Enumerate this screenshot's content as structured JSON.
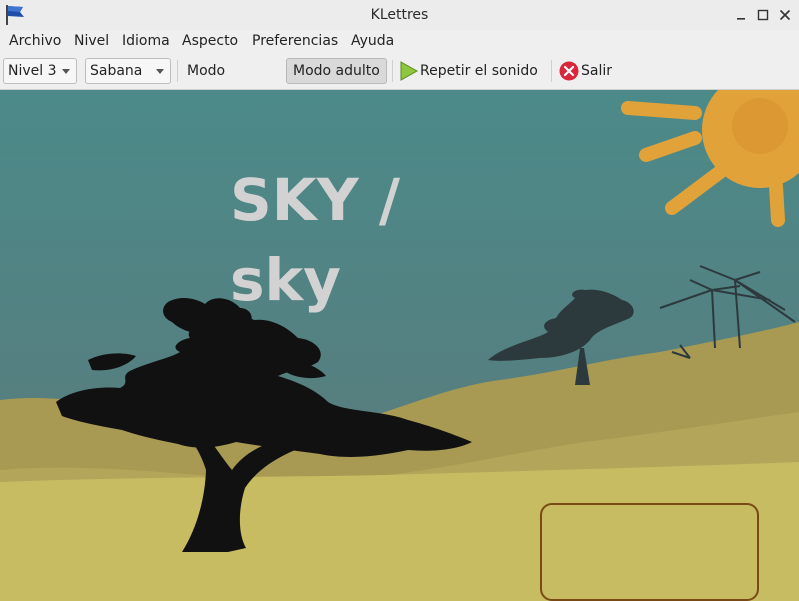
{
  "window": {
    "title": "KLettres"
  },
  "menu": [
    {
      "label": "Archivo"
    },
    {
      "label": "Nivel"
    },
    {
      "label": "Idioma"
    },
    {
      "label": "Aspecto"
    },
    {
      "label": "Preferencias"
    },
    {
      "label": "Ayuda"
    }
  ],
  "toolbar": {
    "level_value": "Nivel 3",
    "theme_value": "Sabana",
    "kid_mode_label": "Modo infantil",
    "adult_mode_label": "Modo adulto",
    "adult_mode_checked": true,
    "replay_label": "Repetir el sonido",
    "quit_label": "Salir"
  },
  "scene": {
    "word_line1": "SKY /",
    "word_line2": "sky",
    "answer_value": "",
    "colors": {
      "sky_top": "#4b8a89",
      "sky_bottom": "#5f7a7a",
      "ground": "#c8bc63",
      "hill": "#a89a52",
      "sun": "#e2a23a",
      "word": "#d2d2d2",
      "box_border": "#7a4a14"
    }
  }
}
